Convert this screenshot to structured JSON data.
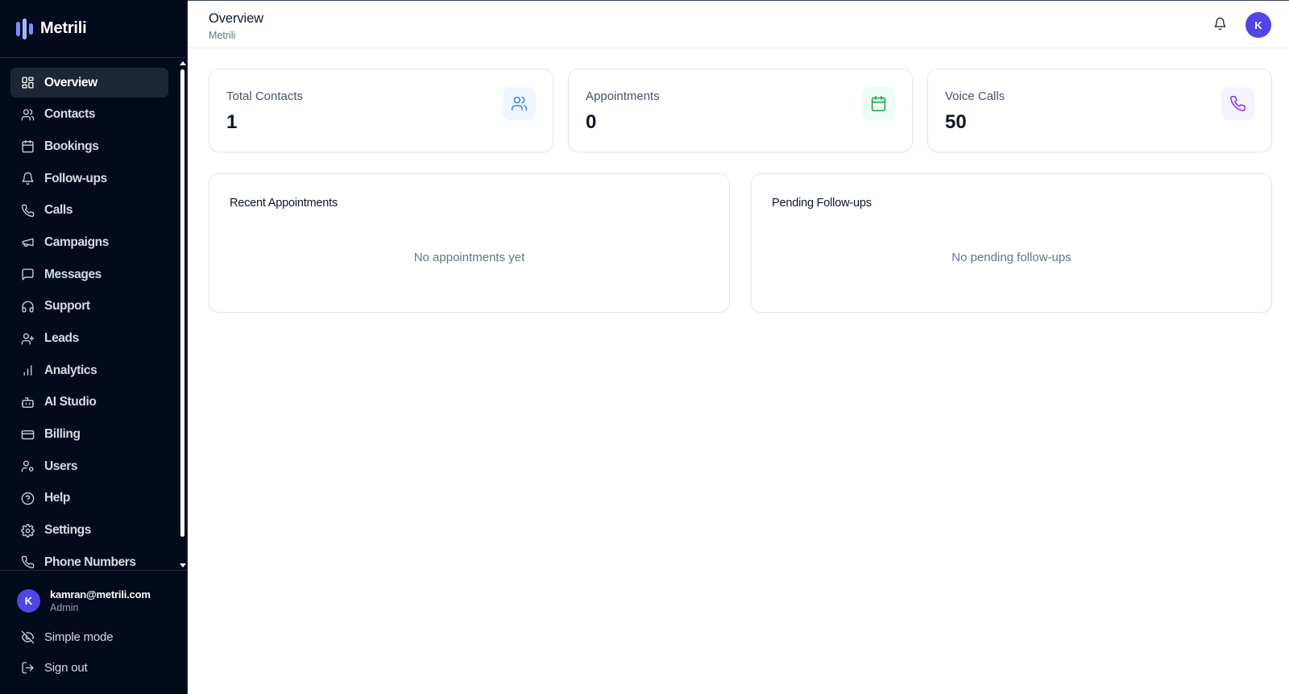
{
  "brand": {
    "name": "Metrili"
  },
  "sidebar": {
    "items": [
      {
        "label": "Overview",
        "icon": "dashboard-icon",
        "active": true
      },
      {
        "label": "Contacts",
        "icon": "users-icon"
      },
      {
        "label": "Bookings",
        "icon": "calendar-icon"
      },
      {
        "label": "Follow-ups",
        "icon": "bell-icon"
      },
      {
        "label": "Calls",
        "icon": "phone-icon"
      },
      {
        "label": "Campaigns",
        "icon": "megaphone-icon"
      },
      {
        "label": "Messages",
        "icon": "message-square-icon"
      },
      {
        "label": "Support",
        "icon": "headphones-icon"
      },
      {
        "label": "Leads",
        "icon": "user-plus-icon"
      },
      {
        "label": "Analytics",
        "icon": "bar-chart-icon"
      },
      {
        "label": "AI Studio",
        "icon": "bot-icon"
      },
      {
        "label": "Billing",
        "icon": "credit-card-icon"
      },
      {
        "label": "Users",
        "icon": "user-cog-icon"
      },
      {
        "label": "Help",
        "icon": "help-circle-icon"
      },
      {
        "label": "Settings",
        "icon": "gear-icon"
      },
      {
        "label": "Phone Numbers",
        "icon": "phone-icon"
      }
    ],
    "user": {
      "initial": "K",
      "email": "kamran@metrili.com",
      "role": "Admin"
    },
    "simple_mode_label": "Simple mode",
    "sign_out_label": "Sign out"
  },
  "header": {
    "title": "Overview",
    "subtitle": "Metrili",
    "avatar_initial": "K"
  },
  "stats": [
    {
      "label": "Total Contacts",
      "value": "1",
      "icon": "users-icon",
      "icon_color": "#3b82f6",
      "icon_bg": "#eff6ff"
    },
    {
      "label": "Appointments",
      "value": "0",
      "icon": "calendar-icon",
      "icon_color": "#16a34a",
      "icon_bg": "#ecfdf5"
    },
    {
      "label": "Voice Calls",
      "value": "50",
      "icon": "phone-icon",
      "icon_color": "#9333ea",
      "icon_bg": "#f5f3ff"
    }
  ],
  "panels": {
    "recent_appointments": {
      "title": "Recent Appointments",
      "empty_text": "No appointments yet"
    },
    "pending_followups": {
      "title": "Pending Follow-ups",
      "empty_text": "No pending follow-ups"
    }
  },
  "colors": {
    "sidebar_bg": "#030a1c",
    "accent": "#4f46e5",
    "brand_mark": "#818cf8"
  }
}
